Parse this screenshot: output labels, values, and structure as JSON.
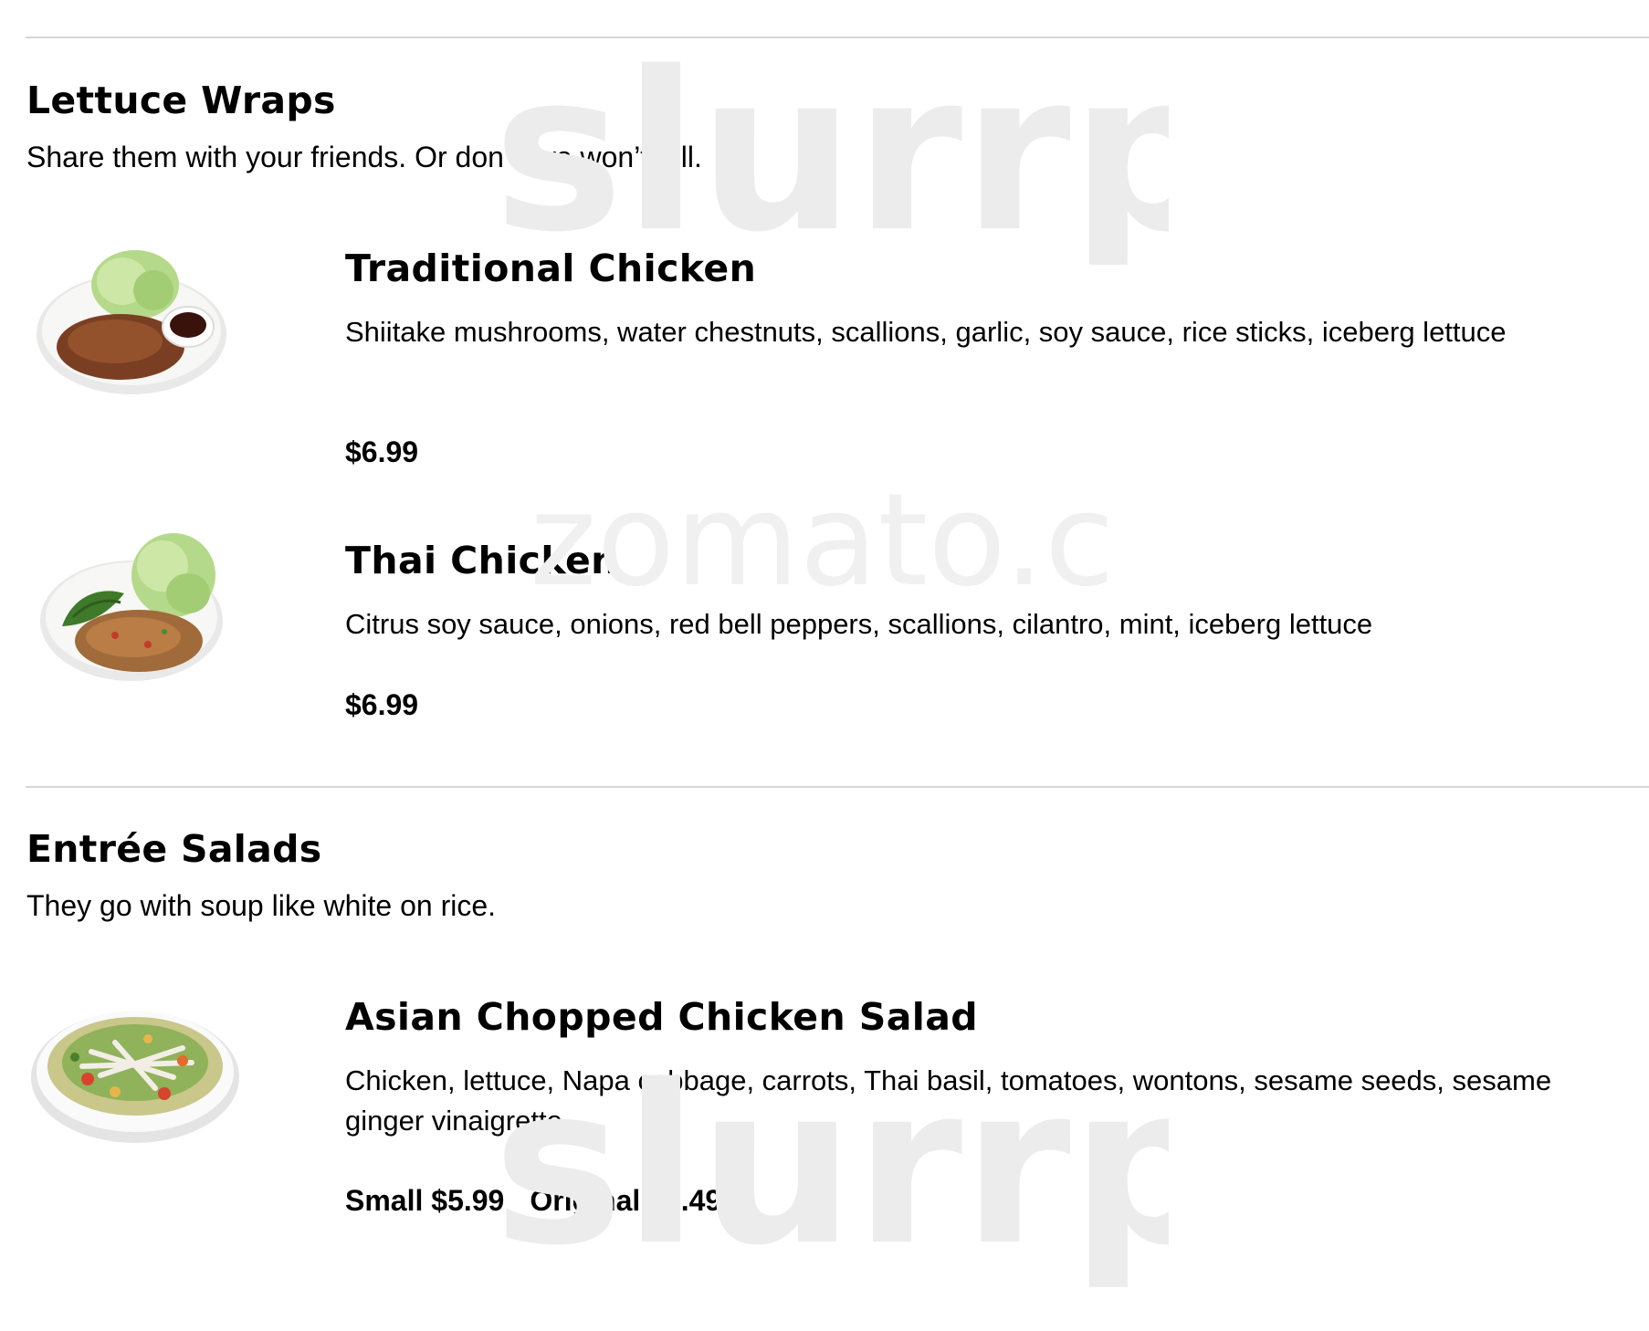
{
  "sections": [
    {
      "title": "Lettuce Wraps",
      "subtitle": "Share them with your friends. Or don’t; we won’t tell.",
      "items": [
        {
          "name": "Traditional Chicken",
          "description": "Shiitake mushrooms, water chestnuts, scallions, garlic, soy sauce, rice sticks, iceberg lettuce",
          "price": "$6.99",
          "image": "lettuce-wrap-plate-icon"
        },
        {
          "name": "Thai Chicken",
          "description": "Citrus soy sauce, onions, red bell peppers, scallions, cilantro, mint, iceberg lettuce",
          "price": "$6.99",
          "image": "lettuce-wrap-plate-icon"
        }
      ]
    },
    {
      "title": "Entrée Salads",
      "subtitle": "They go with soup like white on rice.",
      "items": [
        {
          "name": "Asian Chopped Chicken Salad",
          "description": "Chicken, lettuce, Napa cabbage, carrots, Thai basil, tomatoes, wontons, sesame seeds, sesame ginger vinaigrette",
          "prices": [
            "Small $5.99",
            "Original $7.49"
          ],
          "image": "salad-bowl-icon"
        }
      ]
    }
  ],
  "watermarks": {
    "brand": "slurrpy",
    "secondary": "zomato.com"
  },
  "colors": {
    "rule": "#d6d6d6",
    "watermark_gray": "#ececec",
    "watermark_orange": "#fbe6d2"
  }
}
